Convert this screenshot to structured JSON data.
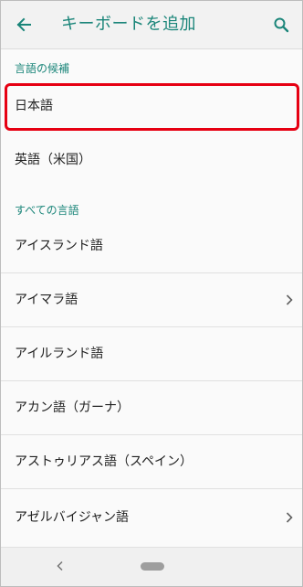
{
  "appbar": {
    "title": "キーボードを追加",
    "back_icon": "arrow-left-icon",
    "search_icon": "search-icon"
  },
  "sections": {
    "suggested_header": "言語の候補",
    "all_header": "すべての言語"
  },
  "suggested": [
    {
      "label": "日本語",
      "highlighted": true
    },
    {
      "label": "英語（米国）"
    }
  ],
  "languages": [
    {
      "label": "アイスランド語",
      "has_chevron": false
    },
    {
      "label": "アイマラ語",
      "has_chevron": true
    },
    {
      "label": "アイルランド語",
      "has_chevron": false
    },
    {
      "label": "アカン語（ガーナ）",
      "has_chevron": false
    },
    {
      "label": "アストゥリアス語（スペイン）",
      "has_chevron": false
    },
    {
      "label": "アゼルバイジャン語",
      "has_chevron": true
    }
  ],
  "colors": {
    "accent": "#1a8579",
    "highlight": "#e60012"
  },
  "navbar": {
    "back_icon": "nav-back-icon",
    "home_icon": "home-pill-icon"
  }
}
